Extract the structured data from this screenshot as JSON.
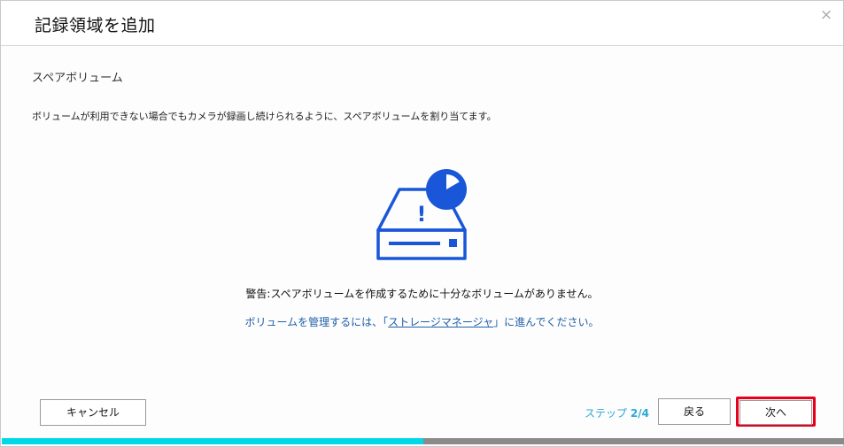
{
  "dialog": {
    "title": "記録領域を追加",
    "close_symbol": "×",
    "section_title": "スペアボリューム",
    "description": "ボリュームが利用できない場合でもカメラが録画し続けられるように、スペアボリュームを割り当てます。"
  },
  "illustration": {
    "icon": "storage-warning-icon",
    "exclamation": "!",
    "color": "#1957d8"
  },
  "warning": {
    "text": "警告:スペアボリュームを作成するために十分なボリュームがありません。"
  },
  "hint": {
    "prefix": "ボリュームを管理するには、「",
    "link_text": "ストレージマネージャ",
    "suffix": "」に進んでください。"
  },
  "footer": {
    "cancel_label": "キャンセル",
    "step_label": "ステップ",
    "step_count": "2/4",
    "back_label": "戻る",
    "next_label": "次へ"
  },
  "progress": {
    "current_step": 2,
    "total_steps": 4,
    "fraction": 0.5,
    "fill_color": "#00d8e8",
    "track_color": "#8a8a8a"
  },
  "colors": {
    "accent": "#29a9d6",
    "link": "#1f5fa8",
    "highlight": "#e8001c"
  }
}
